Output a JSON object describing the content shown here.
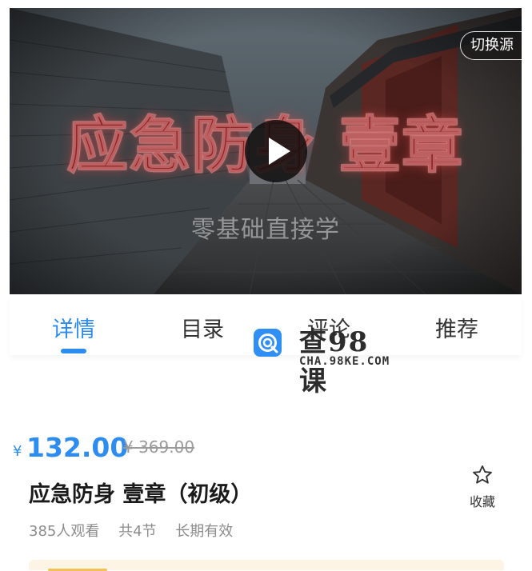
{
  "video": {
    "title_overlay": "应急防身 壹章",
    "subtitle_overlay": "零基础直接学",
    "switch_source_label": "切换源"
  },
  "tabs": [
    {
      "label": "详情",
      "active": true
    },
    {
      "label": "目录",
      "active": false
    },
    {
      "label": "评论",
      "active": false
    },
    {
      "label": "推荐",
      "active": false
    }
  ],
  "watermark": {
    "text": "查98课",
    "url": "CHA.98KE.COM"
  },
  "course": {
    "currency_symbol": "¥",
    "price": "132.00",
    "original_price": "¥ 369.00",
    "title": "应急防身 壹章（初级）",
    "views": "385人观看",
    "lessons": "共4节",
    "validity": "长期有效",
    "favorite_label": "收藏"
  },
  "colors": {
    "accent": "#2d8cf0",
    "title_red": "#8a1f22",
    "muted": "#8c8c8c"
  }
}
